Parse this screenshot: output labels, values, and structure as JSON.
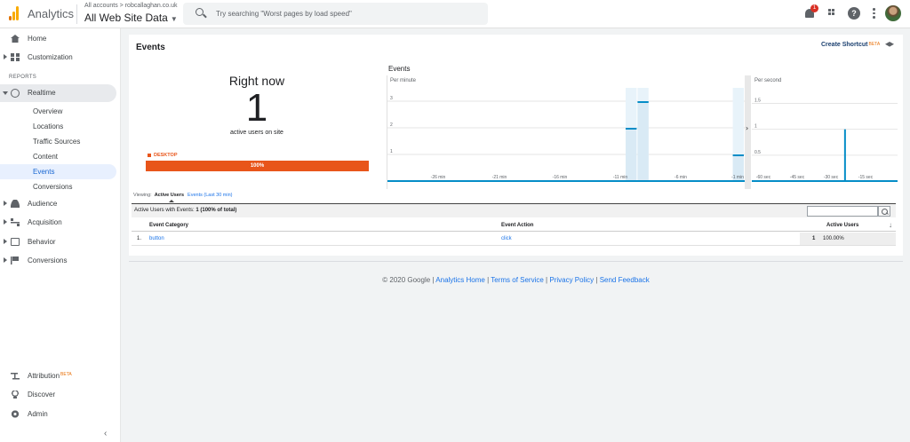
{
  "topbar": {
    "app_title": "Analytics",
    "breadcrumb": "All accounts > robcallaghan.co.uk",
    "account_view": "All Web Site Data",
    "search_placeholder": "Try searching \"Worst pages by load speed\"",
    "notification_count": "1"
  },
  "sidebar": {
    "home": "Home",
    "customization": "Customization",
    "reports_header": "REPORTS",
    "realtime": "Realtime",
    "realtime_sub": [
      "Overview",
      "Locations",
      "Traffic Sources",
      "Content",
      "Events",
      "Conversions"
    ],
    "audience": "Audience",
    "acquisition": "Acquisition",
    "behavior": "Behavior",
    "conversions": "Conversions",
    "attribution": "Attribution",
    "attribution_badge": "BETA",
    "discover": "Discover",
    "admin": "Admin"
  },
  "main": {
    "title": "Events",
    "create_shortcut": "Create Shortcut",
    "shortcut_badge": "BETA",
    "right_now": {
      "title": "Right now",
      "count": "1",
      "subtitle": "active users on site",
      "device_label": "DESKTOP",
      "device_percent": "100%"
    },
    "viewing": {
      "label": "Viewing:",
      "active_tab": "Active Users",
      "other_tab": "Events (Last 30 min)"
    },
    "table": {
      "summary_prefix": "Active Users with Events:",
      "summary_value": "1",
      "summary_suffix": "(100% of total)",
      "headers": [
        "Event Category",
        "Event Action",
        "Active Users"
      ],
      "rows": [
        {
          "index": "1.",
          "category": "button",
          "action": "click",
          "users": "1",
          "percent": "100.00%"
        }
      ]
    }
  },
  "chart_data": [
    {
      "type": "bar",
      "title": "Events",
      "subtitle": "Per minute",
      "x_tick_labels": [
        "-26 min",
        "-21 min",
        "-16 min",
        "-11 min",
        "-6 min",
        "-1 min"
      ],
      "y_tick_labels": [
        "1",
        "2",
        "3"
      ],
      "ylim": [
        0,
        3.5
      ],
      "x_minutes": [
        -30,
        -29,
        -28,
        -27,
        -26,
        -25,
        -24,
        -23,
        -22,
        -21,
        -20,
        -19,
        -18,
        -17,
        -16,
        -15,
        -14,
        -13,
        -12,
        -11,
        -10,
        -9,
        -8,
        -7,
        -6,
        -5,
        -4,
        -3,
        -2,
        -1
      ],
      "values": [
        0,
        0,
        0,
        0,
        0,
        0,
        0,
        0,
        0,
        0,
        0,
        0,
        0,
        0,
        0,
        0,
        0,
        0,
        0,
        0,
        2,
        3,
        0,
        0,
        0,
        0,
        0,
        0,
        0,
        1
      ],
      "color": "#058dc7"
    },
    {
      "type": "bar",
      "subtitle": "Per second",
      "x_tick_labels": [
        "-60 sec",
        "-45 sec",
        "-30 sec",
        "-15 sec"
      ],
      "y_tick_labels": [
        "0.5",
        "1",
        "1.5"
      ],
      "ylim": [
        0,
        1.8
      ],
      "x_seconds_with_events": [
        -22
      ],
      "values": [
        1
      ],
      "color": "#058dc7"
    }
  ],
  "footer": {
    "copyright": "© 2020 Google",
    "links": [
      "Analytics Home",
      "Terms of Service",
      "Privacy Policy",
      "Send Feedback"
    ]
  }
}
